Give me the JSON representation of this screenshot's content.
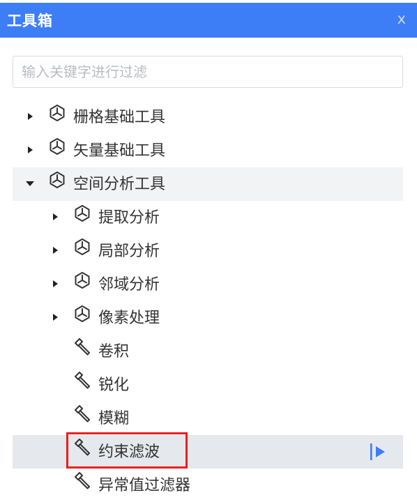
{
  "window": {
    "title": "工具箱",
    "close_label": "x"
  },
  "search": {
    "placeholder": "输入关键字进行过滤"
  },
  "colors": {
    "header": "#3d7ef7",
    "accent": "#3d7ef7",
    "highlight_border": "#e8201f"
  },
  "tree": [
    {
      "label": "栅格基础工具",
      "icon": "cube-icon",
      "expanded": false
    },
    {
      "label": "矢量基础工具",
      "icon": "cube-icon",
      "expanded": false
    },
    {
      "label": "空间分析工具",
      "icon": "cube-icon",
      "expanded": true,
      "children": [
        {
          "label": "提取分析",
          "icon": "cube-icon",
          "expanded": false
        },
        {
          "label": "局部分析",
          "icon": "cube-icon",
          "expanded": false
        },
        {
          "label": "邻域分析",
          "icon": "cube-icon",
          "expanded": false
        },
        {
          "label": "像素处理",
          "icon": "cube-icon",
          "expanded": false
        },
        {
          "label": "卷积",
          "icon": "hammer-icon"
        },
        {
          "label": "锐化",
          "icon": "hammer-icon"
        },
        {
          "label": "模糊",
          "icon": "hammer-icon"
        },
        {
          "label": "约束滤波",
          "icon": "hammer-icon",
          "selected": true,
          "action_icon": "run-icon"
        },
        {
          "label": "异常值过滤器",
          "icon": "hammer-icon"
        }
      ]
    }
  ]
}
